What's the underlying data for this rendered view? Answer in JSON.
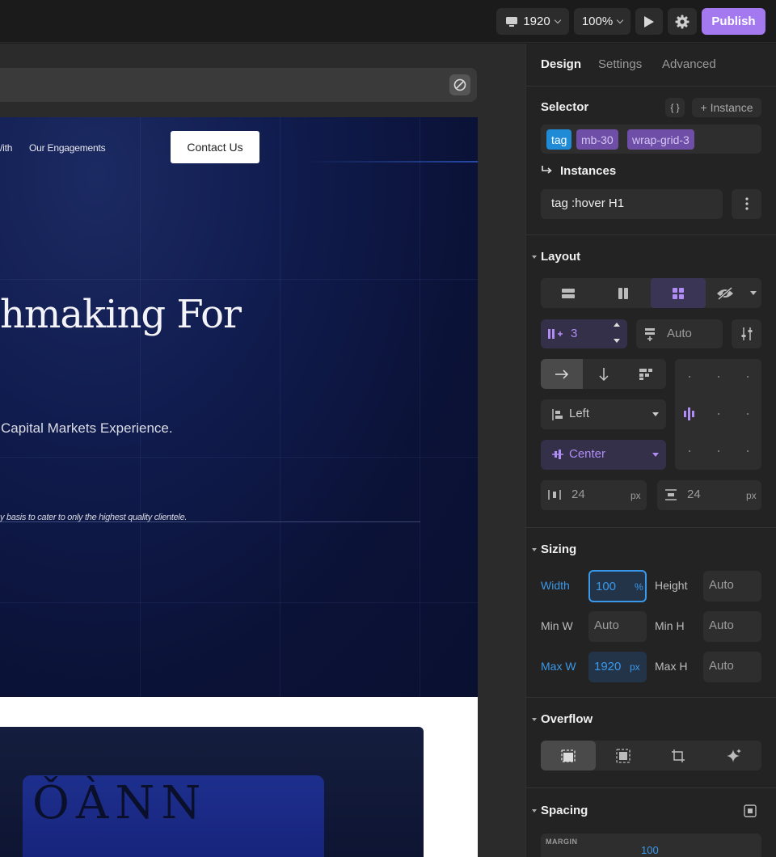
{
  "toolbar": {
    "device_width": "1920",
    "zoom": "100%",
    "publish_label": "Publish"
  },
  "preview": {
    "nav_fragment": "/ith",
    "nav_engagements": "Our Engagements",
    "contact_label": "Contact Us",
    "hero_title": "hmaking For",
    "hero_subtitle": "Capital Markets Experience.",
    "hero_note": "y basis to cater to only the highest quality clientele."
  },
  "panel": {
    "tabs": [
      "Design",
      "Settings",
      "Advanced"
    ],
    "selector": {
      "title": "Selector",
      "braces": "{ }",
      "instance_button": "+ Instance",
      "chips": [
        "tag",
        "mb-30",
        "wrap-grid-3"
      ]
    },
    "instances": {
      "title": "Instances",
      "value": "tag :hover H1"
    },
    "layout": {
      "title": "Layout",
      "columns": "3",
      "rows": "Auto",
      "align_x": "Left",
      "align_y": "Center",
      "gap_x": "24",
      "gap_y": "24",
      "unit": "px"
    },
    "sizing": {
      "title": "Sizing",
      "width_label": "Width",
      "width_value": "100",
      "width_unit": "%",
      "height_label": "Height",
      "height_value": "Auto",
      "min_w_label": "Min W",
      "min_w_value": "Auto",
      "min_h_label": "Min H",
      "min_h_value": "Auto",
      "max_w_label": "Max W",
      "max_w_value": "1920",
      "max_w_unit": "px",
      "max_h_label": "Max H",
      "max_h_value": "Auto"
    },
    "overflow": {
      "title": "Overflow"
    },
    "spacing": {
      "title": "Spacing",
      "margin_label": "MARGIN",
      "margin_top": "100"
    }
  },
  "colors": {
    "accent_purple": "#a479f0",
    "selection_blue": "#1f8bd6",
    "panel_bg": "#232323"
  }
}
